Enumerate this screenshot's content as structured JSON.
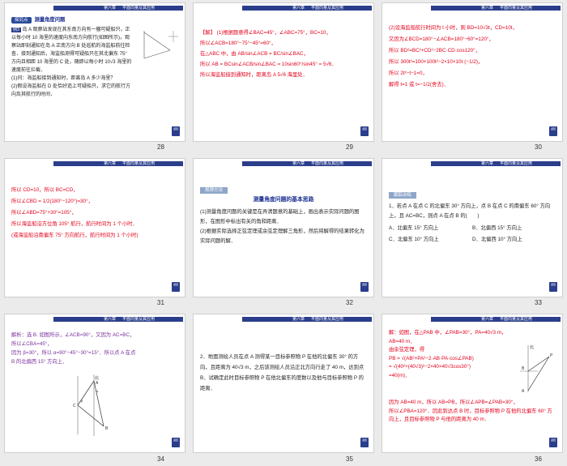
{
  "header": {
    "chapter": "第六章",
    "section": "平面向量及其应用"
  },
  "slides": [
    {
      "number": "28",
      "tag": "探究点",
      "tag_title": "测量角度问题",
      "example": "例3",
      "lines": [
        "岛 A 观察站发现在其东南方向有一艘可疑船只，正以每小时 10 海里的速度向东南方向航行(如图所示)，观察站即刻通知在岛 A 正南方向 B 处巡航的海监船前往检查．接到通知后，海监船测得可疑船只在其北偏东 75° 方向且相距 10 海里的 C 处，随即以每小时 10√3 海里的速度前往拦截．",
        "(1)问：海监船接到通知时，距离岛 A 多少海里？",
        "(2)假设海监船在 D 处恰好追上可疑船只，求它的航行方向及其航行的时间．"
      ]
    },
    {
      "number": "29",
      "lines": [
        "【解】 (1)根据题意得∠BAC=45°，∠ABC=75°，BC=10，",
        "所以∠ACB=180°−75°−45°=60°，",
        "在△ABC 中，由 AB/sin∠ACB = BC/sin∠BAC，",
        "所以 AB = BCsin∠ACB/sin∠BAC = 10sin60°/sin45° = 5√6．",
        "所以海监船接到通知时，距离岛 A 5√6 海里处．"
      ]
    },
    {
      "number": "30",
      "lines": [
        "(2)设海监船航行时间为 t 小时，则 BD=10√3t，CD=10t，",
        "又因为∠BCD=180°−∠ACB=180°−60°=120°，",
        "所以 BD²=BC²+CD²−2BC·CD·cos120°，",
        "所以 300t²=100+100t²−2×10×10t·(−1/2)，",
        "所以 2t²−t−1=0，",
        "解得 t=1 或 t=−1/2(舍去)．"
      ]
    },
    {
      "number": "31",
      "lines": [
        "所以 CD=10，所以 BC=CD，",
        "所以∠CBD = 1/2(180°−120°)=30°，",
        "所以∠ABD=75°+30°=105°，",
        "所以海监船沿方位角 105° 航行，航行时间为 1 个小时．",
        "(或海监船沿南偏东 75° 方向航行，航行时间为 1 个小时)"
      ]
    },
    {
      "number": "32",
      "ribbon": "规律方法",
      "title": "测量角度问题的基本思路",
      "lines": [
        "(1)测量角度问题的关键是在弄清题意的基础上，画出表示实际问题的图形，在图形中标出有关的角和距离．",
        "(2)根据实际选择正弦定理或余弦定理解三角形，然后将解得的结果转化为实际问题的解．"
      ]
    },
    {
      "number": "33",
      "ribbon": "跟踪训练",
      "question": "1．若点 A 在点 C 的北偏东 30° 方向上，点 B 在点 C 的南偏东 60° 方向上，且 AC=BC，则点 A 在点 B 的(　　)",
      "options": [
        "A．北偏东 15° 方向上",
        "B．北偏西 15° 方向上",
        "C．北偏东 10° 方向上",
        "D．北偏西 10° 方向上"
      ]
    },
    {
      "number": "34",
      "lines": [
        "解析：选 B. 如图所示，∠ACB=90°，又因为 AC=BC，",
        "所以∠CBA=45°，",
        "因为 β=30°，所以 α=90°−45°−30°=15°．所以点 A 在点",
        "B 的北偏西 15° 方向上．"
      ],
      "fig_labels": [
        "北",
        "A",
        "C",
        "B",
        "α",
        "β"
      ]
    },
    {
      "number": "35",
      "lines": [
        "2．地面测绘人员在点 A 测得某一目标参照物 P 在他的北偏东 30° 的方向，且距离为 40√3 m，之后该测绘人员沿正北方向行走了 40 m，达到点 B．试确定此时目标参照物 P 在他北偏东的度数以及他与目标参照物 P 的距离．"
      ]
    },
    {
      "number": "36",
      "lines": [
        "解：如图，在△PAB 中，∠PAB=30°，PA=40√3 m，AB=40 m．",
        "由余弦定理，得",
        "PB = √(AB²+PA²−2·AB·PA·cos∠PAB)",
        "= √(40²+(40√3)²−2×40×40√3cos30°)",
        "=40(m)．",
        "因为 AB=40 m，所以 AB=PB，所以∠APB=∠PAB=30°，",
        "所以∠PBA=120°．因此到达点 B 时，目标参照物 P 在他的北偏东 60° 方向上，且目标参照物 P 与他的距离为 40 m．"
      ],
      "fig_labels": [
        "北",
        "P",
        "B",
        "A"
      ]
    }
  ],
  "button_label": "返回"
}
